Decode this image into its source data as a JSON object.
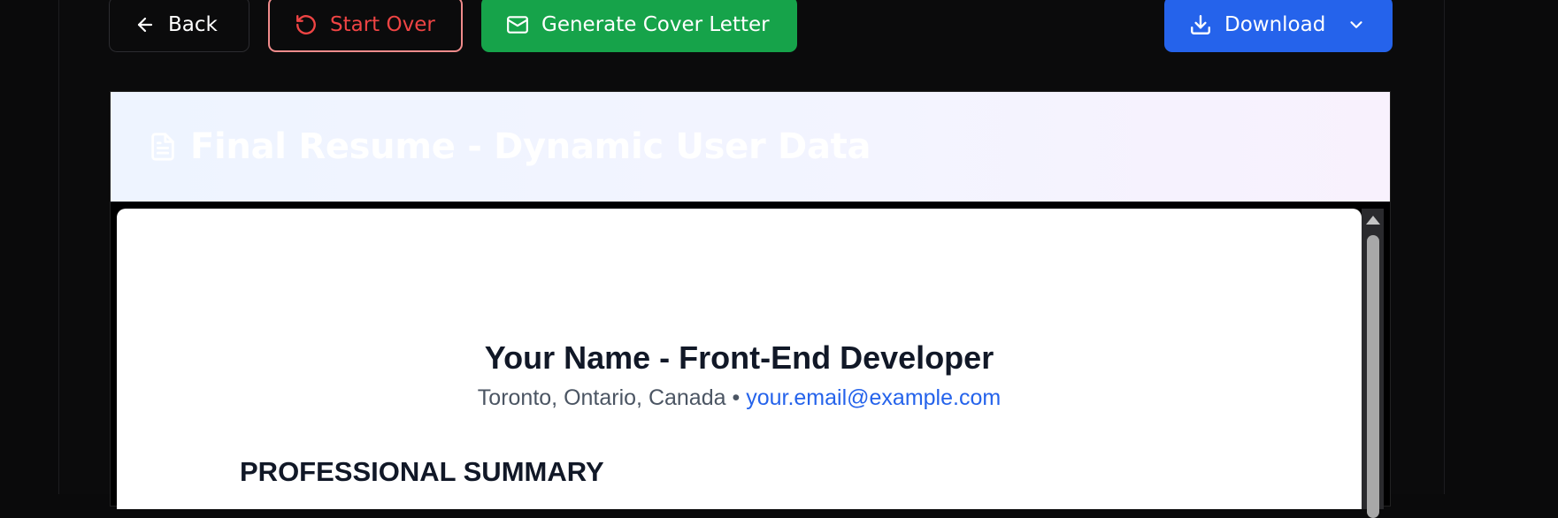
{
  "toolbar": {
    "back_label": "Back",
    "start_over_label": "Start Over",
    "cover_letter_label": "Generate Cover Letter",
    "download_label": "Download"
  },
  "card": {
    "title": "Final Resume - Dynamic User Data"
  },
  "resume": {
    "name": "Your Name - Front-End Developer",
    "location": "Toronto, Ontario, Canada",
    "separator": "•",
    "email": "your.email@example.com",
    "section_summary": "PROFESSIONAL SUMMARY"
  },
  "colors": {
    "back_border": "#2c2c30",
    "start_over": "#ef4444",
    "cover_letter_bg": "#16a34a",
    "download_bg": "#2563eb",
    "link": "#2563eb"
  },
  "icons": {
    "back": "arrow-left-icon",
    "start_over": "rotate-ccw-icon",
    "cover_letter": "mail-icon",
    "download": "download-icon",
    "download_menu": "chevron-down-icon",
    "card_title": "file-text-icon"
  }
}
